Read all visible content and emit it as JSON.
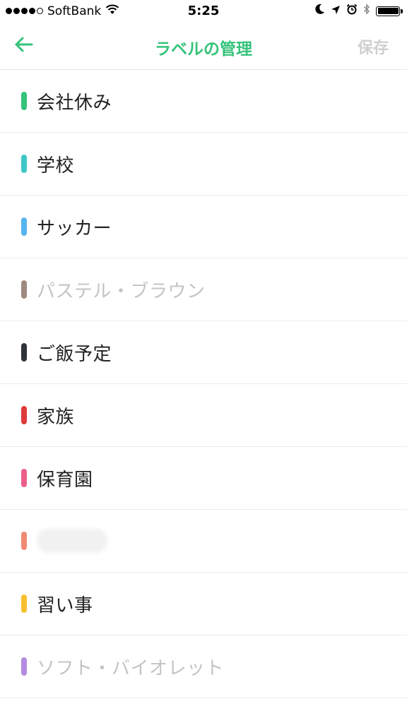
{
  "status_bar": {
    "carrier": "SoftBank",
    "time": "5:25",
    "signal_dots": 5,
    "signal_filled": 4
  },
  "nav": {
    "title": "ラベルの管理",
    "save_label": "保存",
    "accent_color": "#35c37a"
  },
  "labels": [
    {
      "text": "会社休み",
      "color": "#35c37a",
      "disabled": false
    },
    {
      "text": "学校",
      "color": "#3ec7c8",
      "disabled": false
    },
    {
      "text": "サッカー",
      "color": "#56b4f0",
      "disabled": false
    },
    {
      "text": "パステル・ブラウン",
      "color": "#9e8a80",
      "disabled": true
    },
    {
      "text": "ご飯予定",
      "color": "#2f3236",
      "disabled": false
    },
    {
      "text": "家族",
      "color": "#df3b3b",
      "disabled": false
    },
    {
      "text": "保育園",
      "color": "#ec5f8a",
      "disabled": false
    },
    {
      "text": "",
      "color": "#f08a74",
      "disabled": false,
      "obscured": true
    },
    {
      "text": "習い事",
      "color": "#f7c02e",
      "disabled": false
    },
    {
      "text": "ソフト・バイオレット",
      "color": "#b48be0",
      "disabled": true
    }
  ]
}
